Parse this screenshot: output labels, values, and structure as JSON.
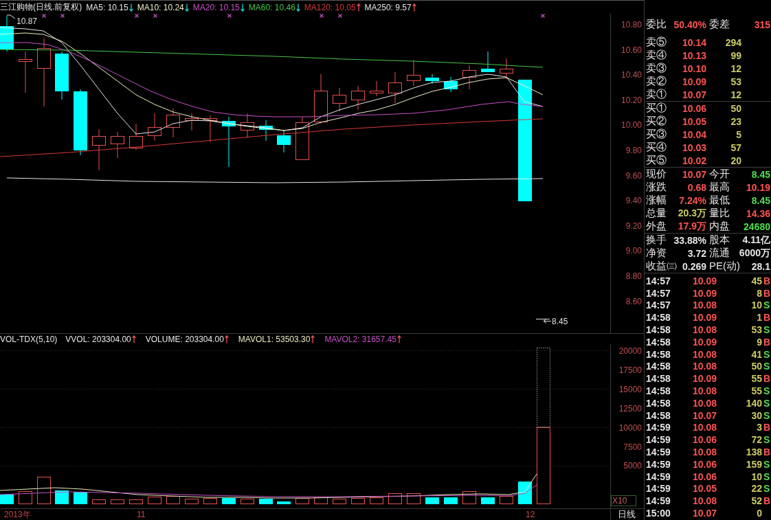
{
  "price_chart": {
    "title": "三江购物(日线.前复权)",
    "indicators": [
      {
        "label": "MA5: 10.15",
        "color": "#e8e8e8",
        "rising": false
      },
      {
        "label": "MA10: 10.24",
        "color": "#f0f0c8",
        "rising": false
      },
      {
        "label": "MA20: 10.15",
        "color": "#c850c8",
        "rising": false
      },
      {
        "label": "MA60: 10.46",
        "color": "#48c848",
        "rising": false
      },
      {
        "label": "MA120: 10.05",
        "color": "#d83838",
        "rising": true
      },
      {
        "label": "MA250: 9.57",
        "color": "#e8e8e8",
        "rising": true
      }
    ],
    "axis_labels": [
      "10.80",
      "10.60",
      "10.40",
      "10.20",
      "10.00",
      "9.80",
      "9.60",
      "9.40",
      "9.20",
      "9.00",
      "8.80",
      "8.60"
    ],
    "high_label": "10.87",
    "low_label": "8.45"
  },
  "volume_chart": {
    "title": "VOL-TDX(5,10)",
    "indicators": [
      {
        "label": "VVOL: 203304.00",
        "color": "#e8e8e8",
        "rising": true
      },
      {
        "label": "VOLUME: 203304.00",
        "color": "#e8e8e8",
        "rising": true
      },
      {
        "label": "MAVOL1: 53503.30",
        "color": "#ececc0",
        "rising": true
      },
      {
        "label": "MAVOL2: 31657.45",
        "color": "#c850c8",
        "rising": true
      }
    ],
    "axis_labels": [
      "20000",
      "17500",
      "15000",
      "12500",
      "10000",
      "7500",
      "5000"
    ],
    "multiplier": "X10"
  },
  "date_axis": {
    "labels": [
      "2013年",
      "11",
      "12"
    ],
    "period": "日线"
  },
  "quote_panel": {
    "order_ratio": {
      "cells": [
        {
          "label": "委比",
          "value": "50.40%",
          "color": "#ff5454"
        },
        {
          "label": "委差",
          "value": "315",
          "color": "#ff5454"
        }
      ]
    },
    "asks": [
      {
        "label": "卖⑤",
        "price": "10.14",
        "volume": "294"
      },
      {
        "label": "卖④",
        "price": "10.13",
        "volume": "99"
      },
      {
        "label": "卖③",
        "price": "10.10",
        "volume": "12"
      },
      {
        "label": "卖②",
        "price": "10.09",
        "volume": "53"
      },
      {
        "label": "卖①",
        "price": "10.07",
        "volume": "12"
      }
    ],
    "bids": [
      {
        "label": "买①",
        "price": "10.06",
        "volume": "50"
      },
      {
        "label": "买②",
        "price": "10.05",
        "volume": "23"
      },
      {
        "label": "买③",
        "price": "10.04",
        "volume": "5"
      },
      {
        "label": "买④",
        "price": "10.03",
        "volume": "57"
      },
      {
        "label": "买⑤",
        "price": "10.02",
        "volume": "20"
      }
    ],
    "stats": [
      {
        "cells": [
          {
            "label": "现价",
            "value": "10.07",
            "color": "#ff5454"
          },
          {
            "label": "今开",
            "value": "8.45",
            "color": "#4fe04f"
          }
        ]
      },
      {
        "cells": [
          {
            "label": "涨跌",
            "value": "0.68",
            "color": "#ff5454"
          },
          {
            "label": "最高",
            "value": "10.19",
            "color": "#ff5454"
          }
        ]
      },
      {
        "cells": [
          {
            "label": "涨幅",
            "value": "7.24%",
            "color": "#ff5454"
          },
          {
            "label": "最低",
            "value": "8.45",
            "color": "#4fe04f"
          }
        ]
      },
      {
        "cells": [
          {
            "label": "总量",
            "value": "20.3万",
            "color": "#cccc66"
          },
          {
            "label": "量比",
            "value": "14.36",
            "color": "#ff5454"
          }
        ]
      },
      {
        "cells": [
          {
            "label": "外盘",
            "value": "17.9万",
            "color": "#ff5454"
          },
          {
            "label": "内盘",
            "value": "24680",
            "color": "#4fe04f"
          }
        ]
      }
    ],
    "fundamentals": [
      {
        "cells": [
          {
            "label": "换手",
            "value": "33.88%",
            "color": "#e6e6e6"
          },
          {
            "label": "股本",
            "value": "4.11亿",
            "color": "#e6e6e6"
          }
        ]
      },
      {
        "cells": [
          {
            "label": "净资",
            "value": "3.72",
            "color": "#e6e6e6"
          },
          {
            "label": "流通",
            "value": "6000万",
            "color": "#e6e6e6"
          }
        ]
      },
      {
        "cells": [
          {
            "label": "收益㈢",
            "value": "0.269",
            "color": "#e6e6e6"
          },
          {
            "label": "PE(动)",
            "value": "28.1",
            "color": "#e6e6e6"
          }
        ]
      }
    ],
    "trades": [
      {
        "time": "14:57",
        "price": "10.09",
        "volume": "45",
        "side": "B",
        "kind": "buy"
      },
      {
        "time": "14:57",
        "price": "10.09",
        "volume": "8",
        "side": "B",
        "kind": "buy"
      },
      {
        "time": "14:57",
        "price": "10.08",
        "volume": "10",
        "side": "S",
        "kind": "sell"
      },
      {
        "time": "14:58",
        "price": "10.09",
        "volume": "1",
        "side": "B",
        "kind": "buy"
      },
      {
        "time": "14:58",
        "price": "10.08",
        "volume": "53",
        "side": "S",
        "kind": "sell"
      },
      {
        "time": "14:58",
        "price": "10.09",
        "volume": "9",
        "side": "B",
        "kind": "buy"
      },
      {
        "time": "14:58",
        "price": "10.08",
        "volume": "41",
        "side": "S",
        "kind": "sell"
      },
      {
        "time": "14:58",
        "price": "10.08",
        "volume": "50",
        "side": "S",
        "kind": "sell"
      },
      {
        "time": "14:58",
        "price": "10.09",
        "volume": "55",
        "side": "B",
        "kind": "buy"
      },
      {
        "time": "14:58",
        "price": "10.08",
        "volume": "55",
        "side": "S",
        "kind": "sell"
      },
      {
        "time": "14:58",
        "price": "10.08",
        "volume": "140",
        "side": "S",
        "kind": "sell"
      },
      {
        "time": "14:58",
        "price": "10.07",
        "volume": "30",
        "side": "S",
        "kind": "sell"
      },
      {
        "time": "14:59",
        "price": "10.08",
        "volume": "3",
        "side": "B",
        "kind": "buy"
      },
      {
        "time": "14:59",
        "price": "10.06",
        "volume": "72",
        "side": "S",
        "kind": "sell"
      },
      {
        "time": "14:59",
        "price": "10.08",
        "volume": "138",
        "side": "B",
        "kind": "buy"
      },
      {
        "time": "14:59",
        "price": "10.06",
        "volume": "159",
        "side": "S",
        "kind": "sell"
      },
      {
        "time": "14:59",
        "price": "10.06",
        "volume": "10",
        "side": "S",
        "kind": "sell"
      },
      {
        "time": "14:59",
        "price": "10.05",
        "volume": "22",
        "side": "S",
        "kind": "sell"
      },
      {
        "time": "14:59",
        "price": "10.08",
        "volume": "52",
        "side": "B",
        "kind": "buy"
      },
      {
        "time": "15:00",
        "price": "10.07",
        "volume": "0"
      }
    ]
  }
}
